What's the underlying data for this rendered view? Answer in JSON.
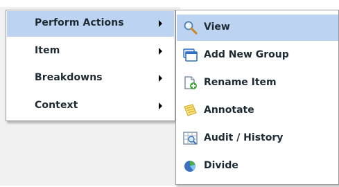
{
  "colors": {
    "highlight": "#bcd4f2",
    "menu_border": "#9a9a9a",
    "text": "#1e2a33",
    "background_panel": "#f1f1f1"
  },
  "main_menu": {
    "items": [
      {
        "label": "Perform Actions",
        "has_submenu": true,
        "active": true
      },
      {
        "label": "Item",
        "has_submenu": true,
        "active": false
      },
      {
        "label": "Breakdowns",
        "has_submenu": true,
        "active": false
      },
      {
        "label": "Context",
        "has_submenu": true,
        "active": false
      }
    ]
  },
  "submenu": {
    "items": [
      {
        "label": "View",
        "icon": "magnifier-icon",
        "active": true
      },
      {
        "label": "Add New Group",
        "icon": "add-group-icon",
        "active": false
      },
      {
        "label": "Rename Item",
        "icon": "rename-document-icon",
        "active": false
      },
      {
        "label": "Annotate",
        "icon": "notepad-icon",
        "active": false
      },
      {
        "label": "Audit / History",
        "icon": "audit-history-icon",
        "active": false
      },
      {
        "label": "Divide",
        "icon": "pie-chart-icon",
        "active": false
      }
    ]
  }
}
